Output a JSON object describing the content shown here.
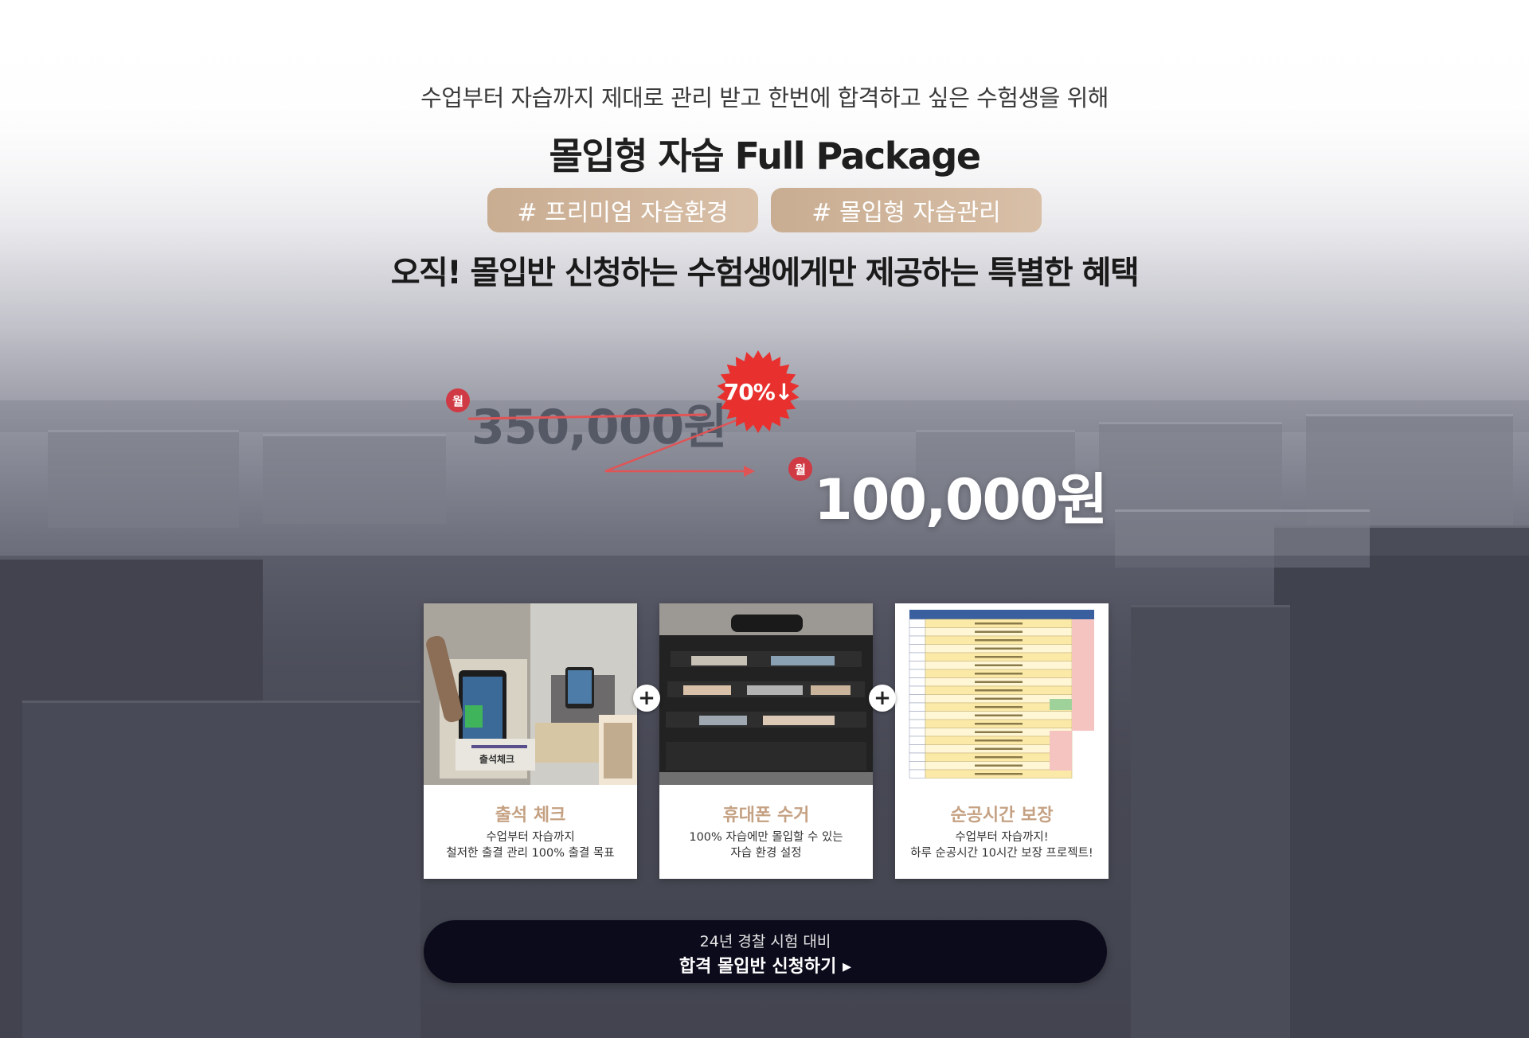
{
  "header": {
    "subtitle": "수업부터 자습까지 제대로 관리 받고 한번에 합격하고 싶은 수험생을 위해",
    "title": "몰입형 자습 Full Package",
    "tags": [
      "# 프리미엄 자습환경",
      "# 몰입형 자습관리"
    ],
    "benefit": "오직! 몰입반 신청하는 수험생에게만 제공하는 특별한 혜택"
  },
  "pricing": {
    "old_badge": "월",
    "old_price": "350,000원",
    "discount": "70%↓",
    "new_badge": "월",
    "new_price": "100,000원"
  },
  "features": [
    {
      "title": "출석 체크",
      "desc": "수업부터 자습까지\n철저한 출결 관리 100% 출결 목표",
      "img_label": "출석체크"
    },
    {
      "title": "휴대폰 수거",
      "desc": "100% 자습에만 몰입할 수 있는\n자습 환경 설정"
    },
    {
      "title": "순공시간 보장",
      "desc": "수업부터 자습까지!\n하루 순공시간 10시간 보장 프로젝트!"
    }
  ],
  "cta": {
    "line1": "24년 경찰 시험 대비",
    "line2": "합격 몰입반 신청하기 ▸"
  },
  "colors": {
    "accent_tag": "#c9ad92",
    "feature_title": "#c5a183",
    "discount_burst": "#e8312f",
    "cta_bg": "#0b0b1c"
  }
}
